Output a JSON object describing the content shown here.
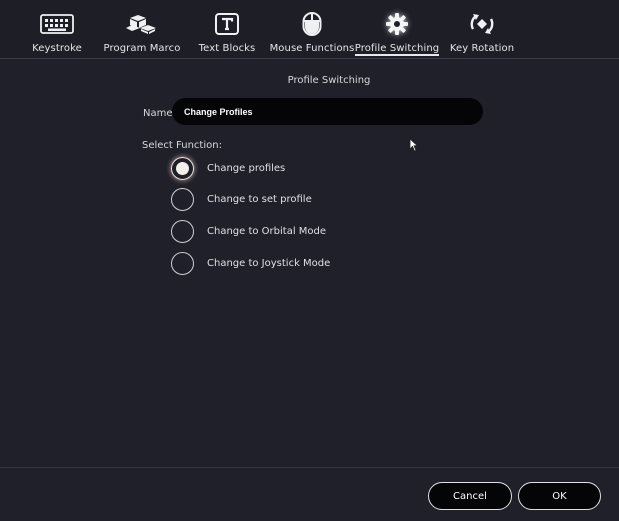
{
  "tabs": [
    {
      "label": "Keystroke",
      "icon": "keyboard-icon",
      "active": false
    },
    {
      "label": "Program Marco",
      "icon": "blocks-icon",
      "active": false
    },
    {
      "label": "Text Blocks",
      "icon": "text-block-icon",
      "active": false
    },
    {
      "label": "Mouse Functions",
      "icon": "mouse-icon",
      "active": false
    },
    {
      "label": "Profile Switching",
      "icon": "gear-icon",
      "active": true
    },
    {
      "label": "Key Rotation",
      "icon": "rotation-icon",
      "active": false
    }
  ],
  "section_title": "Profile Switching",
  "name_field": {
    "label": "Name",
    "value": "Change Profiles"
  },
  "select_function": {
    "label": "Select Function:",
    "options": [
      {
        "label": "Change profiles",
        "checked": true
      },
      {
        "label": "Change to set profile",
        "checked": false
      },
      {
        "label": "Change to Orbital Mode",
        "checked": false
      },
      {
        "label": "Change to Joystick Mode",
        "checked": false
      }
    ]
  },
  "buttons": {
    "cancel": "Cancel",
    "ok": "OK"
  },
  "colors": {
    "background": "#1f2029",
    "input_bg": "#050508",
    "text": "#e6e6e8"
  }
}
